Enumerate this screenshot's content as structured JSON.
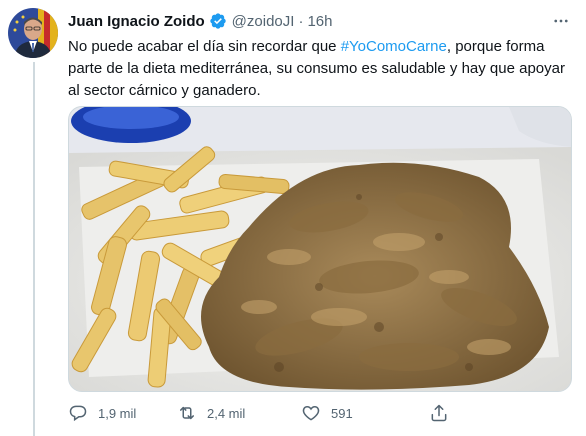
{
  "tweet": {
    "display_name": "Juan Ignacio Zoido",
    "handle": "@zoidoJI",
    "separator": "·",
    "time": "16h",
    "text_before": "No puede acabar el día sin recordar que ",
    "hashtag": "#YoComoCarne",
    "text_after": ", porque forma parte de la dieta mediterránea, su consumo es saludable y hay que apoyar al sector cárnico y ganadero."
  },
  "icons": {
    "verified": "verified-badge-icon",
    "more": "more-options-icon",
    "reply": "reply-icon",
    "retweet": "retweet-icon",
    "like": "like-heart-icon",
    "share": "share-icon"
  },
  "actions": {
    "replies": "1,9 mil",
    "retweets": "2,4 mil",
    "likes": "591"
  },
  "colors": {
    "accent": "#1d9bf0",
    "text": "#0f1419",
    "muted": "#536471"
  }
}
